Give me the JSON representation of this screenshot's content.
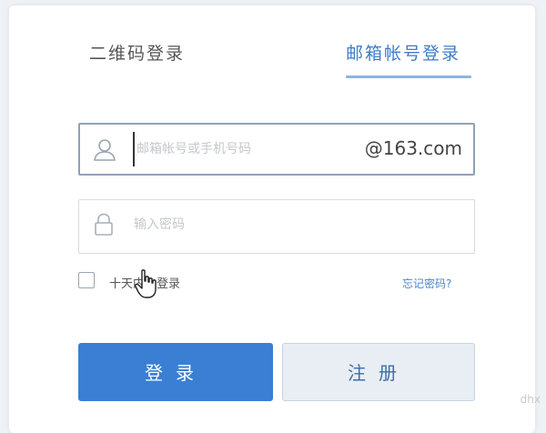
{
  "tabs": {
    "qr_login": "二维码登录",
    "email_login": "邮箱帐号登录"
  },
  "account": {
    "placeholder": "邮箱帐号或手机号码",
    "domain_suffix": "@163.com"
  },
  "password": {
    "placeholder": "输入密码"
  },
  "remember": {
    "label": "十天内免登录"
  },
  "forgot_password": "忘记密码?",
  "buttons": {
    "login": "登录",
    "register": "注册"
  },
  "watermark": "dhx",
  "colors": {
    "accent": "#3a7fd4",
    "tab_active": "#3e7cc8",
    "register_bg": "#e9eef5"
  }
}
